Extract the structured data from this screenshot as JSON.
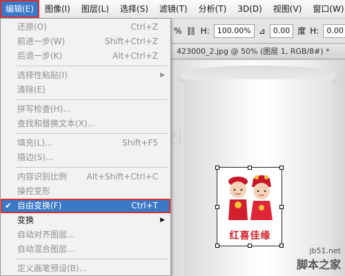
{
  "menubar": {
    "items": [
      "编辑(E)",
      "图像(I)",
      "图层(L)",
      "选择(S)",
      "滤镜(T)",
      "分析(T)",
      "3D(D)",
      "视图(V)",
      "窗口(W)"
    ]
  },
  "options": {
    "w_pct": "%",
    "h_label": "H:",
    "h_value": "100.00%",
    "angle_value": "0.00",
    "deg_label": "度",
    "h2_label": "H:",
    "h2_value": "0.00"
  },
  "document": {
    "tab_title": "423000_2.jpg @ 50% (图层 1, RGB/8#) *"
  },
  "canvas": {
    "watermark": "gt_yanzi",
    "artwork_caption": "红喜佳缘",
    "site_url": "jb51.net",
    "site_name": "脚本之家"
  },
  "menu": {
    "undo": {
      "label": "还原(O)",
      "shortcut": "Ctrl+Z"
    },
    "step_forward": {
      "label": "前进一步(W)",
      "shortcut": "Shift+Ctrl+Z"
    },
    "step_backward": {
      "label": "后退一步(K)",
      "shortcut": "Alt+Ctrl+Z"
    },
    "paste_special": {
      "label": "选择性粘贴(I)"
    },
    "clear": {
      "label": "清除(E)"
    },
    "spell_check": {
      "label": "拼写检查(H)..."
    },
    "find_replace": {
      "label": "查找和替换文本(X)..."
    },
    "fill": {
      "label": "填充(L)...",
      "shortcut": "Shift+F5"
    },
    "stroke": {
      "label": "描边(S)..."
    },
    "content_aware_scale": {
      "label": "内容识别比例",
      "shortcut": "Alt+Shift+Ctrl+C"
    },
    "puppet_warp": {
      "label": "操控变形"
    },
    "free_transform": {
      "label": "自由变换(F)",
      "shortcut": "Ctrl+T"
    },
    "transform": {
      "label": "变换"
    },
    "auto_align": {
      "label": "自动对齐图层..."
    },
    "auto_blend": {
      "label": "自动混合图层..."
    },
    "define_brush": {
      "label": "定义画笔预设(B)..."
    }
  },
  "colors": {
    "highlight": "#3a78c8",
    "annotation_outline": "#d23232",
    "caption_red": "#d0202a"
  }
}
